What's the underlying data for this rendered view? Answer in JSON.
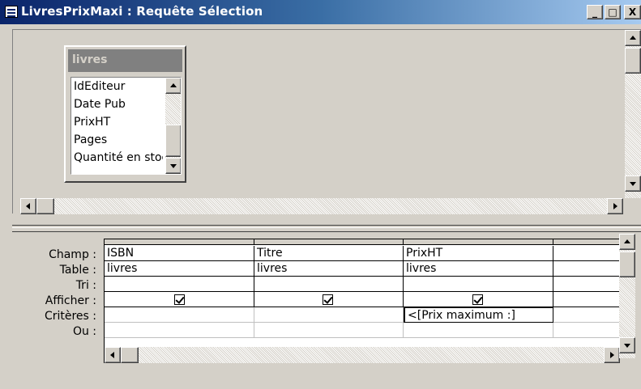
{
  "window": {
    "title": "LivresPrixMaxi : Requête Sélection",
    "minimize_label": "_",
    "maximize_label": "□",
    "close_label": "X"
  },
  "table_panel": {
    "title": "livres",
    "fields": [
      "IdEditeur",
      "Date Pub",
      "PrixHT",
      "Pages",
      "Quantité en stock"
    ]
  },
  "design_grid": {
    "row_labels": [
      "Champ :",
      "Table :",
      "Tri :",
      "Afficher :",
      "Critères :",
      "Ou :"
    ],
    "columns": [
      {
        "field": "ISBN",
        "table": "livres",
        "sort": "",
        "show": true,
        "criteria": "",
        "or": ""
      },
      {
        "field": "Titre",
        "table": "livres",
        "sort": "",
        "show": true,
        "criteria": "",
        "or": ""
      },
      {
        "field": "PrixHT",
        "table": "livres",
        "sort": "",
        "show": true,
        "criteria": "<[Prix maximum :]",
        "or": ""
      },
      {
        "field": "",
        "table": "",
        "sort": "",
        "show": false,
        "criteria": "",
        "or": ""
      }
    ]
  },
  "colors": {
    "title_gradient_start": "#0a246a",
    "title_gradient_end": "#a6caf0",
    "face": "#d4d0c8",
    "inactive_caption": "#808080"
  }
}
